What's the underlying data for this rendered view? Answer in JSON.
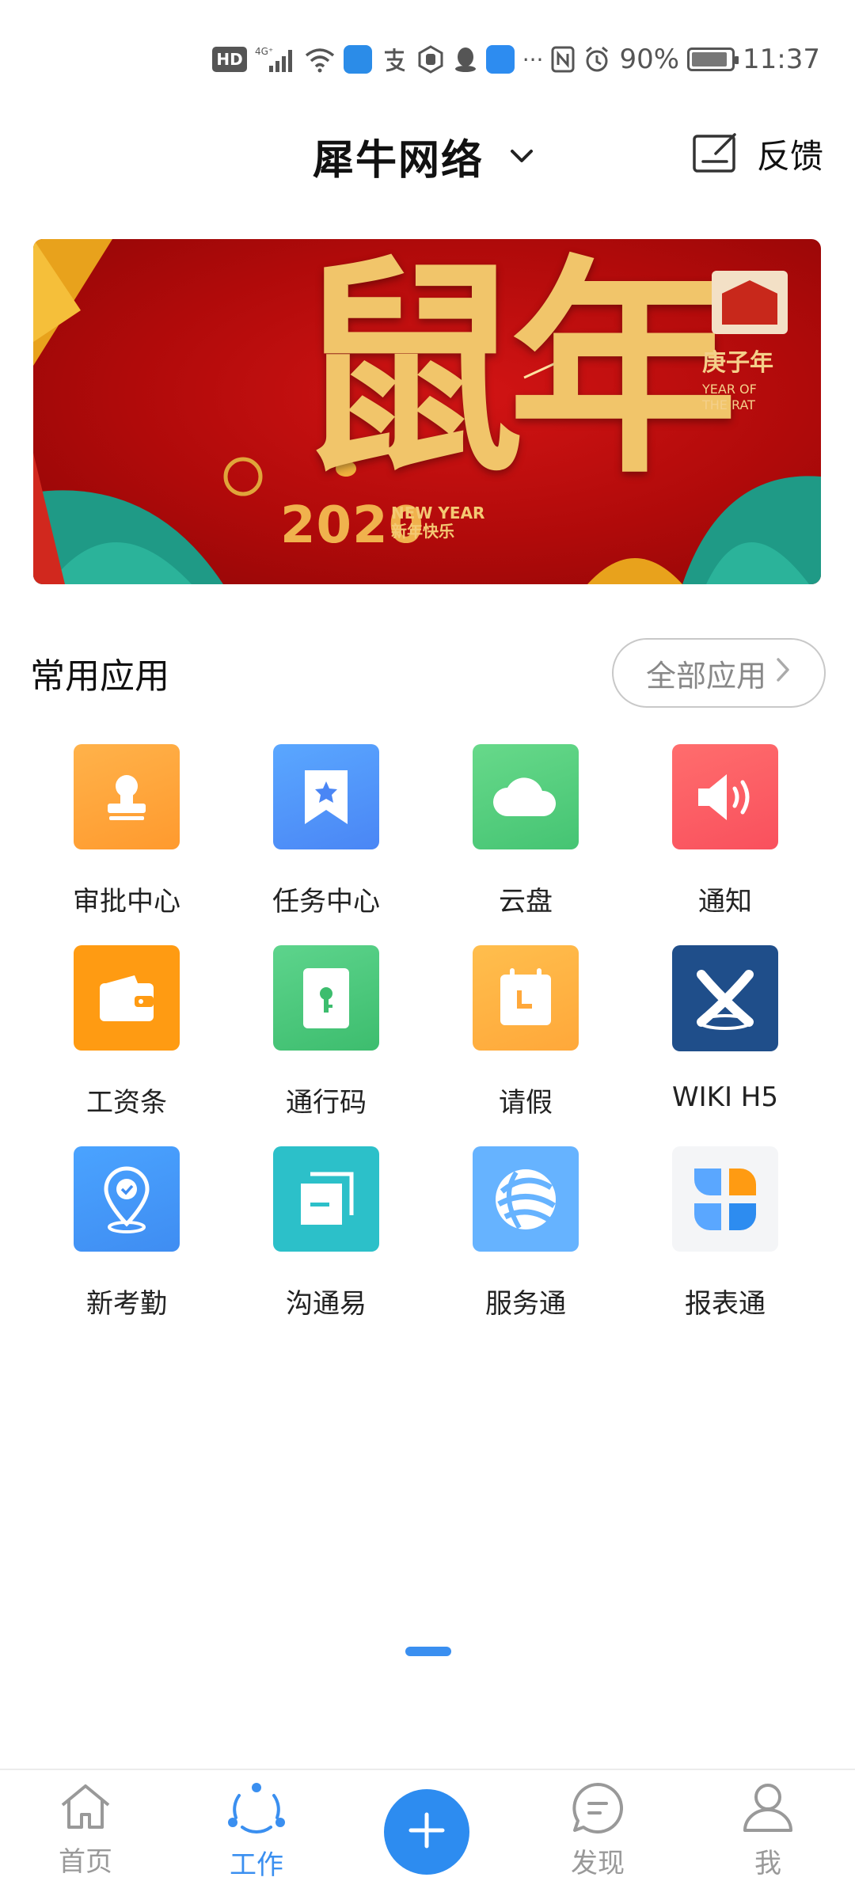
{
  "status_bar": {
    "hd": "HD",
    "network": "4G⁺",
    "battery": "90%",
    "time": "11:37",
    "dots": "···"
  },
  "header": {
    "org_name": "犀牛网络",
    "feedback_label": "反馈"
  },
  "banner": {
    "title": "鼠年",
    "year": "2020",
    "new_year_en": "NEW YEAR",
    "new_year_cn": "新年快乐",
    "zodiac_cn": "庚子年",
    "zodiac_en_1": "YEAR OF",
    "zodiac_en_2": "THE RAT"
  },
  "section": {
    "title": "常用应用",
    "all_apps_label": "全部应用"
  },
  "apps": [
    {
      "label": "审批中心",
      "icon": "stamp-icon",
      "color": "#ffa63c"
    },
    {
      "label": "任务中心",
      "icon": "bookmark-star-icon",
      "color": "#4f8ff7"
    },
    {
      "label": "云盘",
      "icon": "cloud-icon",
      "color": "#55cd7d"
    },
    {
      "label": "通知",
      "icon": "speaker-icon",
      "color": "#fb5c63"
    },
    {
      "label": "工资条",
      "icon": "wallet-icon",
      "color": "#ff9b12"
    },
    {
      "label": "通行码",
      "icon": "key-lock-icon",
      "color": "#4cc479"
    },
    {
      "label": "请假",
      "icon": "calendar-icon",
      "color": "#ffb040"
    },
    {
      "label": "WIKI H5",
      "icon": "confluence-icon",
      "color": "#1f4e8a"
    },
    {
      "label": "新考勤",
      "icon": "location-check-icon",
      "color": "#4297f7"
    },
    {
      "label": "沟通易",
      "icon": "windows-icon",
      "color": "#2cc0c9"
    },
    {
      "label": "服务通",
      "icon": "swirl-ball-icon",
      "color": "#66b3ff"
    },
    {
      "label": "报表通",
      "icon": "four-petal-icon",
      "color": "#f4f5f7"
    }
  ],
  "bottom_nav": {
    "home": "首页",
    "work": "工作",
    "discover": "发现",
    "me": "我"
  },
  "colors": {
    "accent": "#2d8cf0",
    "inactive": "#999999"
  }
}
